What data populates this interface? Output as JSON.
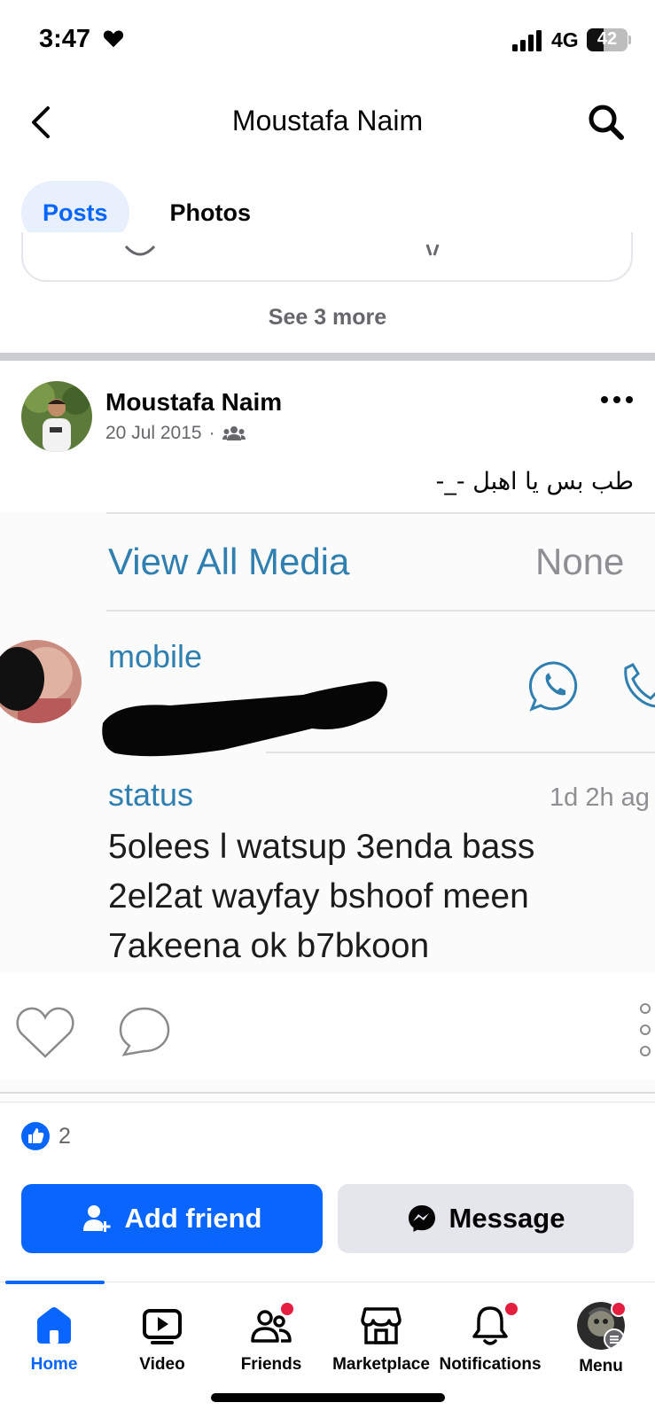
{
  "status_bar": {
    "time": "3:47",
    "network": "4G",
    "battery": "42",
    "battery_level_percent": 42,
    "heart_icon": "heart-icon",
    "signal_icon": "signal-bars-icon"
  },
  "header": {
    "title": "Moustafa Naim",
    "back_icon": "chevron-left-icon",
    "search_icon": "search-icon"
  },
  "tabs": [
    {
      "label": "Posts",
      "active": true
    },
    {
      "label": "Photos",
      "active": false
    }
  ],
  "comments": {
    "see_more": "See 3 more"
  },
  "post": {
    "author": "Moustafa Naim",
    "date": "20 Jul 2015",
    "separator": "·",
    "audience_icon": "friends-audience-icon",
    "more_icon": "more-horizontal-icon",
    "text": "طب بس يا اهبل -_-",
    "image": {
      "view_all_media": "View All Media",
      "none": "None",
      "mobile_label": "mobile",
      "status_label": "status",
      "status_time": "1d 2h ag",
      "status_lines": [
        "5olees l watsup 3enda bass",
        "2el2at wayfay bshoof meen",
        "7akeena ok b7bkoon"
      ],
      "icons": [
        "whatsapp-icon",
        "phone-icon",
        "heart-outline-icon",
        "comment-outline-icon",
        "vertical-dots-icon"
      ]
    },
    "reactions": {
      "like_icon": "like-badge-icon",
      "count": "2"
    }
  },
  "actions": {
    "add_friend": "Add friend",
    "message": "Message",
    "add_friend_icon": "person-plus-icon",
    "message_icon": "messenger-icon"
  },
  "bottom_nav": [
    {
      "label": "Home",
      "icon": "home-icon",
      "active": true,
      "badge": false
    },
    {
      "label": "Video",
      "icon": "video-icon",
      "active": false,
      "badge": false
    },
    {
      "label": "Friends",
      "icon": "friends-icon",
      "active": false,
      "badge": true
    },
    {
      "label": "Marketplace",
      "icon": "marketplace-icon",
      "active": false,
      "badge": false
    },
    {
      "label": "Notifications",
      "icon": "bell-icon",
      "active": false,
      "badge": true
    },
    {
      "label": "Menu",
      "icon": "profile-avatar-icon",
      "active": false,
      "badge": true
    }
  ],
  "colors": {
    "brand_blue": "#0866ff",
    "tab_active_bg": "#e7f0fc",
    "secondary_text": "#65676b",
    "badge_red": "#e41e3f"
  }
}
